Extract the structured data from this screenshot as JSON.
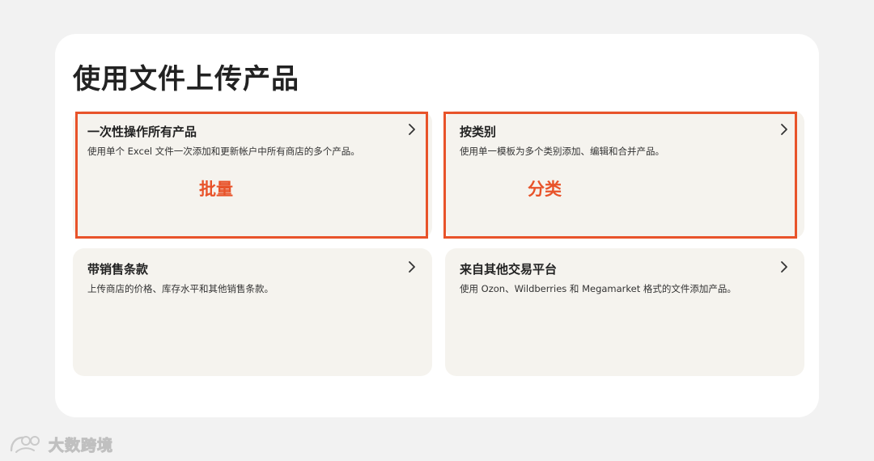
{
  "page": {
    "title": "使用文件上传产品"
  },
  "cards": [
    {
      "title": "一次性操作所有产品",
      "description": "使用单个 Excel 文件一次添加和更新帐户中所有商店的多个产品。",
      "icon": "chevron-right-icon"
    },
    {
      "title": "按类别",
      "description": "使用单一模板为多个类别添加、编辑和合并产品。",
      "icon": "chevron-right-icon"
    },
    {
      "title": "带销售条款",
      "description": "上传商店的价格、库存水平和其他销售条款。",
      "icon": "chevron-right-icon"
    },
    {
      "title": "来自其他交易平台",
      "description": "使用 Ozon、Wildberries 和 Megamarket 格式的文件添加产品。",
      "icon": "chevron-right-icon"
    }
  ],
  "annotations": {
    "batch": "批量",
    "category": "分类",
    "color": "#e8532a"
  },
  "watermark": {
    "text": "大数跨境"
  },
  "colors": {
    "background": "#f2f2f2",
    "panel": "#ffffff",
    "card": "#f5f3ee",
    "highlight": "#e8532a",
    "text": "#222222"
  }
}
